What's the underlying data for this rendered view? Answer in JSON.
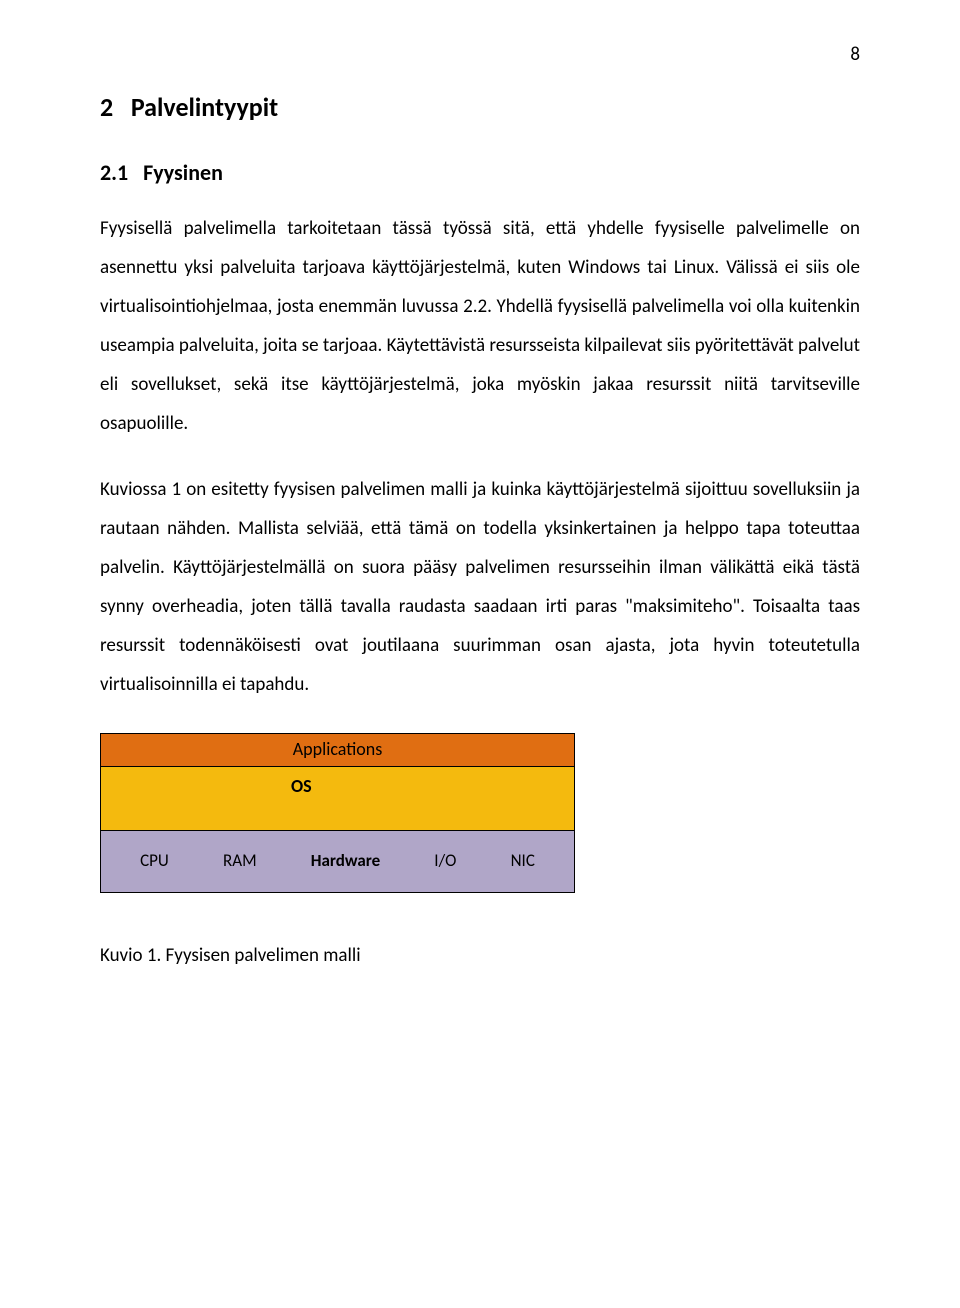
{
  "page_number": "8",
  "heading_main_number": "2",
  "heading_main_text": "Palvelintyypit",
  "heading_sub_number": "2.1",
  "heading_sub_text": "Fyysinen",
  "para1": "Fyysisellä palvelimella tarkoitetaan tässä työssä sitä, että yhdelle fyysiselle palvelimelle on asennettu yksi palveluita tarjoava käyttöjärjestelmä, kuten Windows tai Linux. Välissä ei siis ole virtualisointiohjelmaa, josta enemmän luvussa 2.2. Yhdellä fyysisellä palvelimella voi olla kuitenkin useampia palveluita, joita se tarjoaa. Käytettävistä resursseista kilpailevat siis pyöritettävät palvelut eli sovellukset, sekä itse käyttöjärjestelmä, joka myöskin jakaa resurssit niitä tarvitseville osapuolille.",
  "para2": "Kuviossa 1 on esitetty fyysisen palvelimen malli ja kuinka käyttöjärjestelmä sijoittuu sovelluksiin ja rautaan nähden. Mallista selviää, että tämä on todella yksinkertainen ja helppo tapa toteuttaa palvelin. Käyttöjärjestelmällä on suora pääsy palvelimen resursseihin ilman välikättä eikä tästä synny overheadia, joten tällä tavalla raudasta saadaan irti paras \"maksimiteho\". Toisaalta taas resurssit todennäköisesti ovat joutilaana suurimman osan ajasta, jota hyvin toteutetulla virtualisoinnilla ei tapahdu.",
  "diagram": {
    "applications": "Applications",
    "os": "OS",
    "hardware": {
      "cpu": "CPU",
      "ram": "RAM",
      "hardware": "Hardware",
      "io": "I/O",
      "nic": "NIC"
    },
    "colors": {
      "apps_bg": "#e06e12",
      "os_bg": "#f4ba0e",
      "hw_bg": "#b0a6c8"
    }
  },
  "caption": "Kuvio 1. Fyysisen palvelimen malli"
}
